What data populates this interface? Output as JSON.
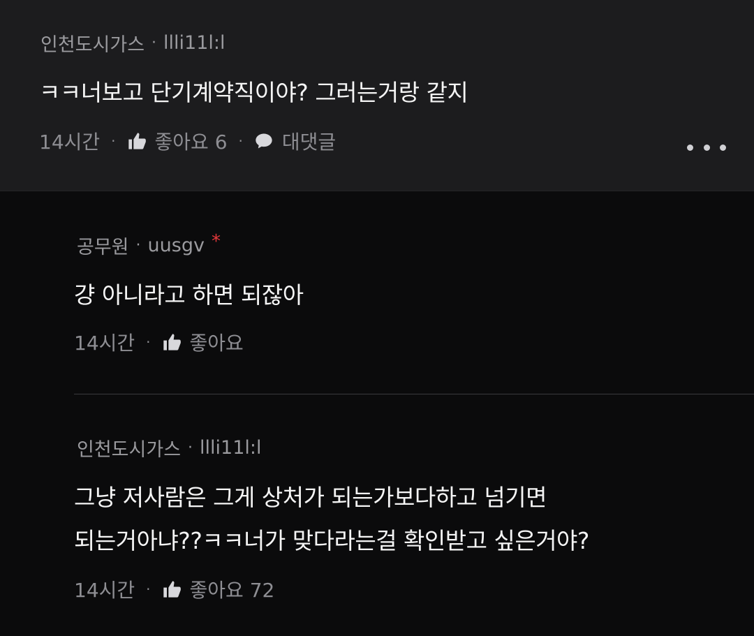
{
  "comments": [
    {
      "author": "인천도시가스",
      "handle": "llli11l:l",
      "text_lines": [
        "ㅋㅋ너보고 단기계약직이야? 그러는거랑 같지"
      ],
      "time": "14시간",
      "like_label": "좋아요 6",
      "reply_label": "대댓글"
    },
    {
      "author": "공무원",
      "handle": "uusgv",
      "badge": "*",
      "text_lines": [
        "걍 아니라고 하면 되잖아"
      ],
      "time": "14시간",
      "like_label": "좋아요"
    },
    {
      "author": "인천도시가스",
      "handle": "llli11l:l",
      "text_lines": [
        "그냥 저사람은 그게 상처가 되는가보다하고 넘기면",
        "되는거아냐??ㅋㅋ너가 맞다라는걸 확인받고 싶은거야?"
      ],
      "time": "14시간",
      "like_label": "좋아요 72"
    }
  ],
  "separator": "·",
  "colors": {
    "accent_badge": "#e5383b",
    "top_background": "#1c1c1e",
    "page_background": "#0b0b0c"
  },
  "icons": [
    "thumbs-up-icon",
    "speech-bubble-icon",
    "more-dots-icon"
  ]
}
